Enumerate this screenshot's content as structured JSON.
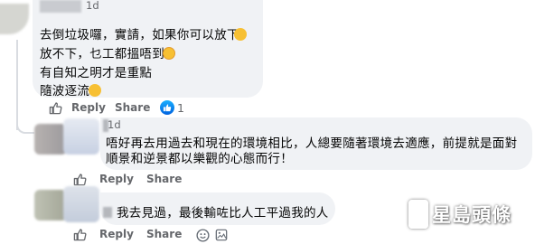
{
  "comments": [
    {
      "time": "1d",
      "lines": [
        "去倒垃圾囉，實請，如果你可以放下",
        "放不下，乜工都搵唔到",
        "有自知之明才是重點",
        "隨波逐流"
      ],
      "actions": {
        "like": "Like",
        "reply": "Reply",
        "share": "Share"
      },
      "reaction_count": "1"
    },
    {
      "time": "1d",
      "lines": [
        "唔好再去用過去和現在的環境相比，人總要隨著環境去適應，前提就是面對",
        "順景和逆景都以樂觀的心態而行！"
      ],
      "actions": {
        "like": "Like",
        "reply": "Reply",
        "share": "Share"
      }
    },
    {
      "time": "1d",
      "lines": [
        "我去見過，最後輸咗比人工平過我的人"
      ],
      "actions": {
        "like": "Like",
        "reply": "Reply",
        "share": "Share"
      }
    }
  ],
  "watermark": {
    "text": "星島頭條"
  },
  "colors": {
    "bubble": "#f0f2f5",
    "meta": "#65676b",
    "like_blue": "#0866ff"
  }
}
